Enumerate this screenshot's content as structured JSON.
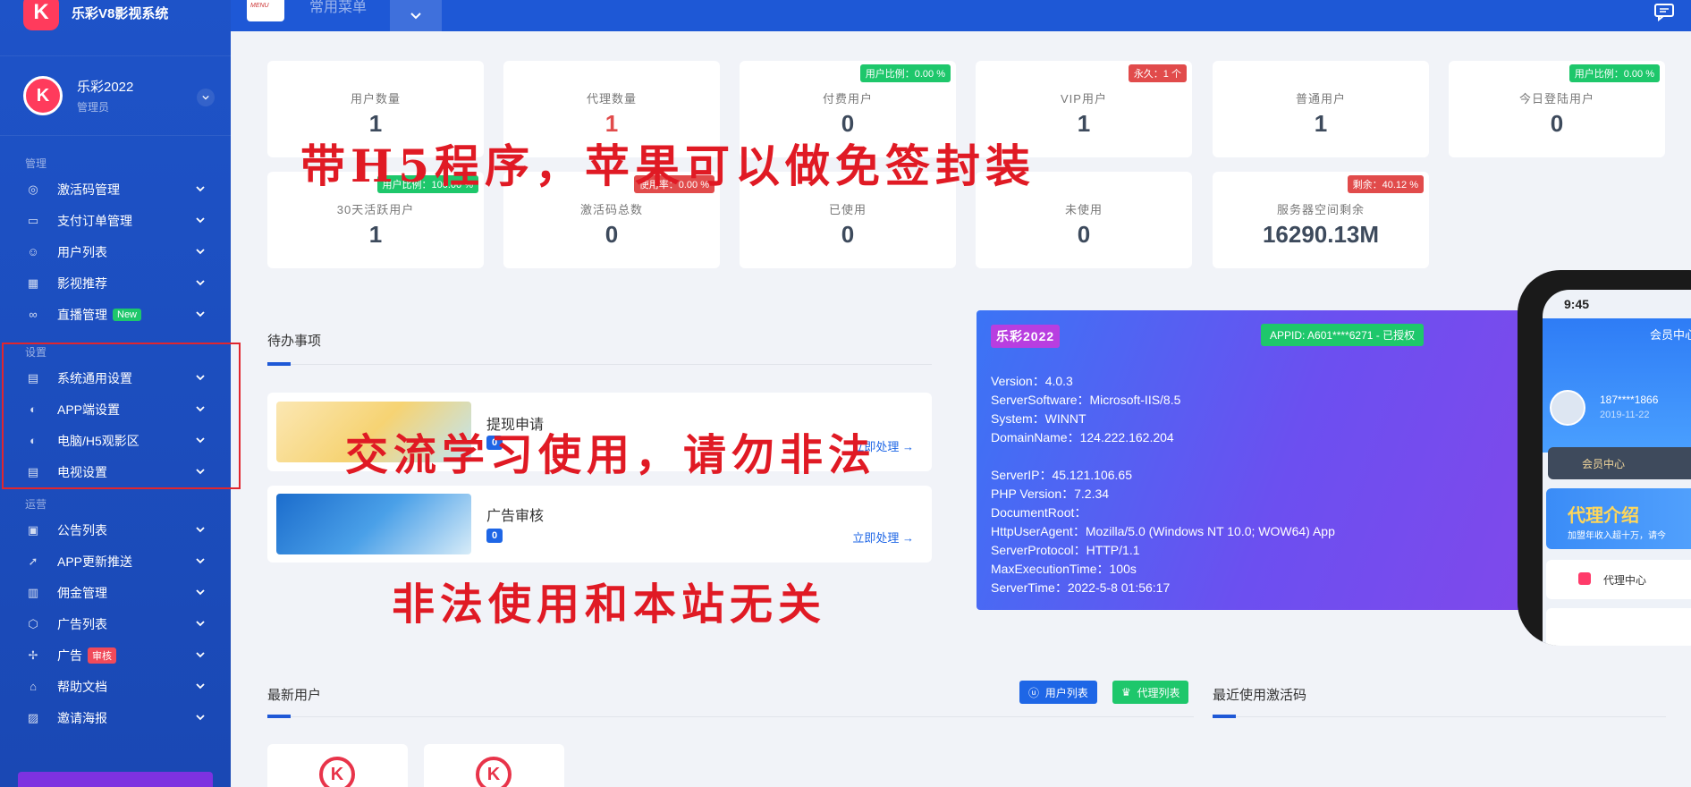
{
  "brand": {
    "logo": "K",
    "title": "乐彩V8影视系统"
  },
  "user": {
    "avatar": "K",
    "name": "乐彩2022",
    "role": "管理员"
  },
  "sidebar": {
    "section_manage": "管理",
    "section_settings": "设置",
    "section_ops": "运营",
    "manage_items": [
      {
        "label": "激活码管理",
        "icon": "fingerprint-icon"
      },
      {
        "label": "支付订单管理",
        "icon": "wallet-icon"
      },
      {
        "label": "用户列表",
        "icon": "users-icon"
      },
      {
        "label": "影视推荐",
        "icon": "film-icon"
      },
      {
        "label": "直播管理",
        "icon": "live-icon",
        "badge": "New"
      }
    ],
    "settings_items": [
      {
        "label": "系统通用设置",
        "icon": "layout-icon"
      },
      {
        "label": "APP端设置",
        "icon": "palette-icon"
      },
      {
        "label": "电脑/H5观影区",
        "icon": "palette-icon"
      },
      {
        "label": "电视设置",
        "icon": "layout-icon"
      }
    ],
    "ops_items": [
      {
        "label": "公告列表",
        "icon": "notice-icon"
      },
      {
        "label": "APP更新推送",
        "icon": "send-icon"
      },
      {
        "label": "佣金管理",
        "icon": "commission-icon"
      },
      {
        "label": "广告列表",
        "icon": "box-icon"
      },
      {
        "label": "广告",
        "icon": "megaphone-icon",
        "badge": "审核"
      },
      {
        "label": "帮助文档",
        "icon": "tag-icon"
      },
      {
        "label": "邀请海报",
        "icon": "image-icon"
      }
    ]
  },
  "topbar": {
    "logo_text": "MENU",
    "title": "常用菜单"
  },
  "stats": [
    {
      "label": "用户数量",
      "value": "1"
    },
    {
      "label": "代理数量",
      "value": "1"
    },
    {
      "label": "付费用户",
      "value": "0",
      "badge": "用户比例：0.00 %"
    },
    {
      "label": "VIP用户",
      "value": "1",
      "badge": "永久：1 个"
    },
    {
      "label": "普通用户",
      "value": "1"
    },
    {
      "label": "今日登陆用户",
      "value": "0",
      "badge": "用户比例：0.00 %"
    },
    {
      "label": "30天活跃用户",
      "value": "1",
      "badge": "用户比例：100.00 %"
    },
    {
      "label": "激活码总数",
      "value": "0",
      "badge": "使用率：0.00 %"
    },
    {
      "label": "已使用",
      "value": "0"
    },
    {
      "label": "未使用",
      "value": "0"
    },
    {
      "label": "服务器空间剩余",
      "value": "16290.13M",
      "badge": "剩余：40.12 %"
    }
  ],
  "todo": {
    "title": "待办事项",
    "items": [
      {
        "title": "提现申请",
        "count": "0",
        "action": "立即处理"
      },
      {
        "title": "广告审核",
        "count": "0",
        "action": "立即处理"
      }
    ]
  },
  "server": {
    "brand": "乐彩2022",
    "appid": "APPID: A601****6271 - 已授权",
    "lines_a": [
      "Version：4.0.3",
      "ServerSoftware：Microsoft-IIS/8.5",
      "System：WINNT",
      "DomainName：124.222.162.204"
    ],
    "lines_b": [
      "ServerIP：45.121.106.65",
      "PHP Version：7.2.34",
      "DocumentRoot：",
      "HttpUserAgent：Mozilla/5.0 (Windows NT 10.0; WOW64) App",
      "ServerProtocol：HTTP/1.1",
      "MaxExecutionTime：100s",
      "ServerTime：2022-5-8 01:56:17"
    ]
  },
  "phone": {
    "time": "9:45",
    "header": "会员中心",
    "phone_number": "187****1866",
    "date": "2019-11-22",
    "vip_label": "会员中心",
    "banner_title": "代理介绍",
    "banner_sub": "加盟年收入超十万，请今",
    "row_label": "代理中心"
  },
  "newest_users": {
    "title": "最新用户",
    "btn_users": "用户列表",
    "btn_agents": "代理列表",
    "tile_logo": "K"
  },
  "recent_codes": {
    "title": "最近使用激活码"
  },
  "watermarks": {
    "line1": "带H5程序，苹果可以做免签封装",
    "line2": "交流学习使用，请勿非法",
    "line3": "非法使用和本站无关"
  },
  "colors": {
    "sidebar": "#1e53c8",
    "accent": "#1e58d6",
    "badge_green": "#1ec76b",
    "badge_red": "#f04a5a",
    "watermark": "#e01a24"
  }
}
